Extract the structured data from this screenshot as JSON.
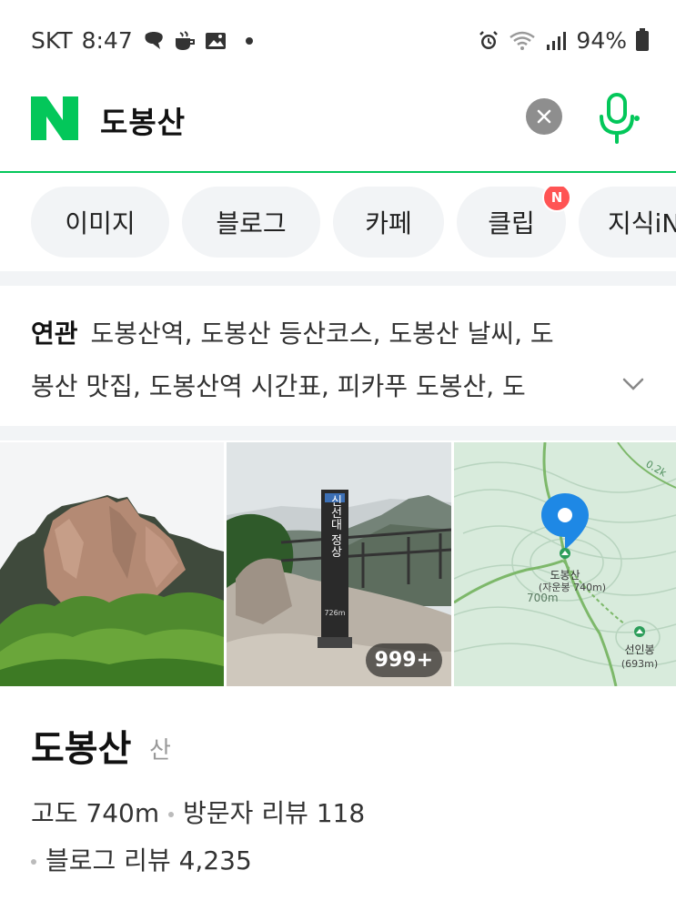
{
  "status_bar": {
    "carrier": "SKT",
    "time": "8:47",
    "battery": "94%",
    "left_icons": [
      "messenger-icon",
      "coffee-icon",
      "gallery-icon"
    ],
    "right_icons": [
      "alarm-icon",
      "wifi-icon",
      "signal-icon",
      "battery-icon"
    ]
  },
  "search": {
    "logo": "N",
    "query": "도봉산",
    "accent_color": "#03c75a"
  },
  "tabs": [
    {
      "label": "이미지"
    },
    {
      "label": "블로그"
    },
    {
      "label": "카페"
    },
    {
      "label": "클립",
      "badge": "N"
    },
    {
      "label": "지식iN"
    }
  ],
  "related": {
    "label": "연관",
    "line1": "도봉산역, 도봉산 등산코스, 도봉산 날씨, 도",
    "line2": "봉산 맛집, 도봉산역 시간표, 피카푸 도봉산, 도"
  },
  "photos": {
    "count_badge": "999+",
    "sign_text": "신선대 정상",
    "sign_sub": "726m",
    "map": {
      "pin_name": "도봉산",
      "pin_sub": "(자운봉 740m)",
      "contour_label": "700m",
      "peak2_name": "선인봉",
      "peak2_sub": "(693m)",
      "trail_label": "0.2k"
    }
  },
  "place": {
    "name": "도봉산",
    "category": "산",
    "altitude": "고도 740m",
    "visitor_reviews": "방문자 리뷰 118",
    "blog_reviews": "블로그 리뷰 4,235"
  }
}
